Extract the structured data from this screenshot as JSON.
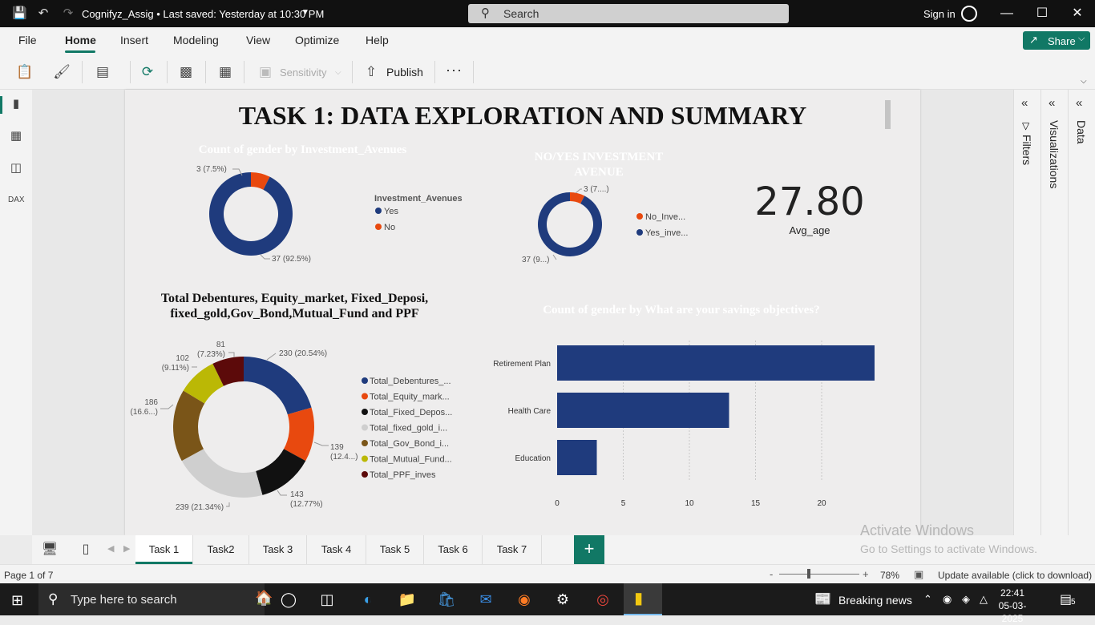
{
  "app": {
    "doc_title": "Cognifyz_Assig • Last saved: Yesterday at 10:30 PM",
    "search_placeholder": "Search",
    "sign_in": "Sign in"
  },
  "menu": {
    "items": [
      "File",
      "Home",
      "Insert",
      "Modeling",
      "View",
      "Optimize",
      "Help"
    ],
    "share": "Share"
  },
  "ribbon": {
    "sensitivity": "Sensitivity",
    "publish": "Publish",
    "more": "···"
  },
  "report": {
    "title": "TASK 1: DATA EXPLORATION AND SUMMARY",
    "kpi": {
      "value": "27.80",
      "label": "Avg_age"
    }
  },
  "chart_data": [
    {
      "type": "pie",
      "title": "Count of gender by Investment_Avenues",
      "legend_title": "Investment_Avenues",
      "categories": [
        "Yes",
        "No"
      ],
      "values": [
        37,
        3
      ],
      "data_labels": [
        "37 (92.5%)",
        "3 (7.5%)"
      ],
      "colors": [
        "#1f3b7d",
        "#e8490f"
      ]
    },
    {
      "type": "pie",
      "title": "NO/YES INVESTMENT AVENUE",
      "categories": [
        "Yes_inve...",
        "No_Inve..."
      ],
      "values": [
        37,
        3
      ],
      "data_labels": [
        "37 (9...)",
        "3 (7....)"
      ],
      "colors": [
        "#1f3b7d",
        "#e8490f"
      ]
    },
    {
      "type": "pie",
      "title": "Total Debentures, Equity_market, Fixed_Deposi, fixed_gold,Gov_Bond,Mutual_Fund and PPF",
      "categories": [
        "Total_Debentures_...",
        "Total_Equity_mark...",
        "Total_Fixed_Depos...",
        "Total_fixed_gold_i...",
        "Total_Gov_Bond_i...",
        "Total_Mutual_Fund...",
        "Total_PPF_inves"
      ],
      "values": [
        230,
        139,
        143,
        239,
        186,
        102,
        81
      ],
      "data_labels": [
        "230 (20.54%)",
        "139 (12.4...)",
        "143 (12.77%)",
        "239 (21.34%)",
        "186 (16.6...)",
        "102 (9.11%)",
        "81 (7.23%)"
      ],
      "colors": [
        "#1f3b7d",
        "#e8490f",
        "#111111",
        "#cfcfcf",
        "#7a5518",
        "#bbb805",
        "#5c0a0a"
      ]
    },
    {
      "type": "bar",
      "orientation": "horizontal",
      "title": "Count of gender by What are your savings objectives?",
      "categories": [
        "Retirement Plan",
        "Health Care",
        "Education"
      ],
      "values": [
        24,
        13,
        3
      ],
      "xlim": [
        0,
        24
      ],
      "xticks": [
        "0",
        "5",
        "10",
        "15",
        "20"
      ],
      "color": "#1f3b7d",
      "grid": true
    }
  ],
  "tabs": [
    "Task 1",
    "Task2",
    "Task 3",
    "Task 4",
    "Task 5",
    "Task 6",
    "Task 7"
  ],
  "panes": {
    "filters": "Filters",
    "visualizations": "Visualizations",
    "data": "Data"
  },
  "watermark": {
    "line1": "Activate Windows",
    "line2": "Go to Settings to activate Windows."
  },
  "status": {
    "page": "Page 1 of 7",
    "zoom": "78%",
    "update": "Update available (click to download)"
  },
  "taskbar": {
    "search_placeholder": "Type here to search",
    "news": "Breaking news",
    "time": "22:41",
    "date": "05-03-2025",
    "notifications": "5"
  }
}
